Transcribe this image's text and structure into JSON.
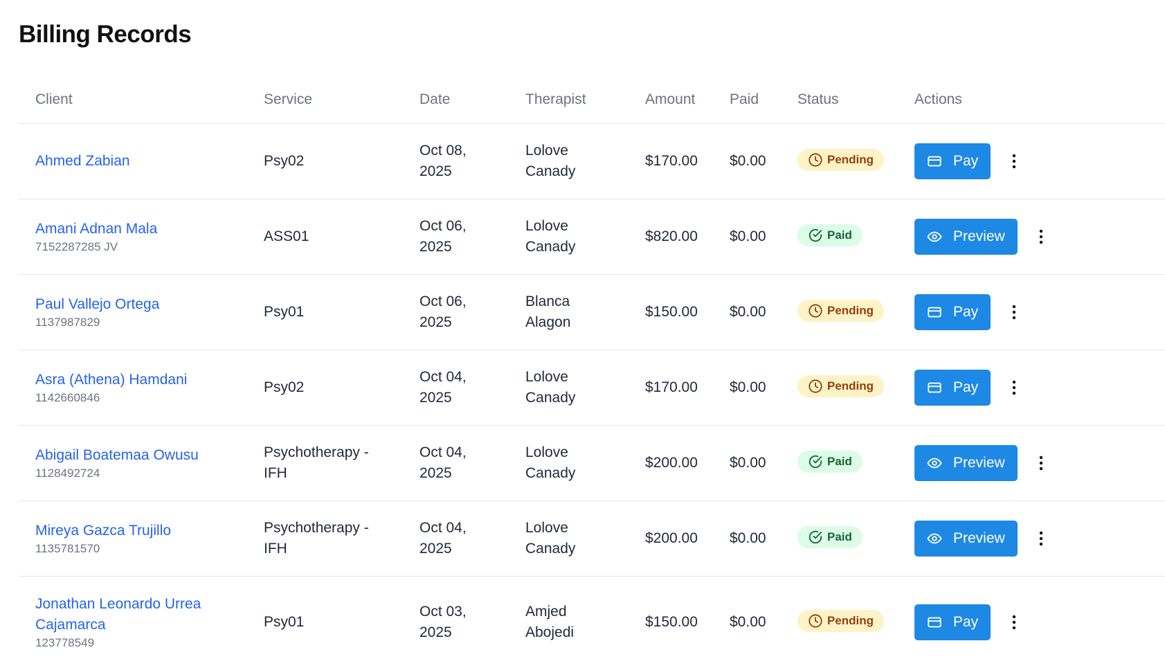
{
  "page": {
    "title": "Billing Records"
  },
  "colors": {
    "link": "#2563eb",
    "primary_button": "#1e88e5",
    "pending_bg": "#fef3c7",
    "paid_bg": "#dcfce7"
  },
  "table": {
    "headers": [
      "Client",
      "Service",
      "Date",
      "Therapist",
      "Amount",
      "Paid",
      "Status",
      "Actions"
    ],
    "rows": [
      {
        "client": "Ahmed Zabian",
        "client_id": "",
        "service": "Psy02",
        "date_line1": "Oct 08,",
        "date_line2": "2025",
        "therapist_line1": "Lolove",
        "therapist_line2": "Canady",
        "amount": "$170.00",
        "paid": "$0.00",
        "status": "Pending",
        "status_icon": "clock-icon",
        "action": "Pay",
        "action_icon": "card-icon"
      },
      {
        "client": "Amani Adnan Mala",
        "client_id": "7152287285 JV",
        "service": "ASS01",
        "date_line1": "Oct 06,",
        "date_line2": "2025",
        "therapist_line1": "Lolove",
        "therapist_line2": "Canady",
        "amount": "$820.00",
        "paid": "$0.00",
        "status": "Paid",
        "status_icon": "check-circle-icon",
        "action": "Preview",
        "action_icon": "eye-icon"
      },
      {
        "client": "Paul Vallejo Ortega",
        "client_id": "1137987829",
        "service": "Psy01",
        "date_line1": "Oct 06,",
        "date_line2": "2025",
        "therapist_line1": "Blanca",
        "therapist_line2": "Alagon",
        "amount": "$150.00",
        "paid": "$0.00",
        "status": "Pending",
        "status_icon": "clock-icon",
        "action": "Pay",
        "action_icon": "card-icon"
      },
      {
        "client": "Asra (Athena) Hamdani",
        "client_id": "1142660846",
        "service": "Psy02",
        "date_line1": "Oct 04,",
        "date_line2": "2025",
        "therapist_line1": "Lolove",
        "therapist_line2": "Canady",
        "amount": "$170.00",
        "paid": "$0.00",
        "status": "Pending",
        "status_icon": "clock-icon",
        "action": "Pay",
        "action_icon": "card-icon"
      },
      {
        "client": "Abigail Boatemaa Owusu",
        "client_id": "1128492724",
        "service_line1": "Psychotherapy -",
        "service_line2": "IFH",
        "date_line1": "Oct 04,",
        "date_line2": "2025",
        "therapist_line1": "Lolove",
        "therapist_line2": "Canady",
        "amount": "$200.00",
        "paid": "$0.00",
        "status": "Paid",
        "status_icon": "check-circle-icon",
        "action": "Preview",
        "action_icon": "eye-icon"
      },
      {
        "client": "Mireya Gazca Trujillo",
        "client_id": "1135781570",
        "service_line1": "Psychotherapy -",
        "service_line2": "IFH",
        "date_line1": "Oct 04,",
        "date_line2": "2025",
        "therapist_line1": "Lolove",
        "therapist_line2": "Canady",
        "amount": "$200.00",
        "paid": "$0.00",
        "status": "Paid",
        "status_icon": "check-circle-icon",
        "action": "Preview",
        "action_icon": "eye-icon"
      },
      {
        "client_line1": "Jonathan Leonardo Urrea",
        "client_line2": "Cajamarca",
        "client_id": "123778549",
        "service": "Psy01",
        "date_line1": "Oct 03,",
        "date_line2": "2025",
        "therapist_line1": "Amjed",
        "therapist_line2": "Abojedi",
        "amount": "$150.00",
        "paid": "$0.00",
        "status": "Pending",
        "status_icon": "clock-icon",
        "action": "Pay",
        "action_icon": "card-icon"
      }
    ]
  }
}
